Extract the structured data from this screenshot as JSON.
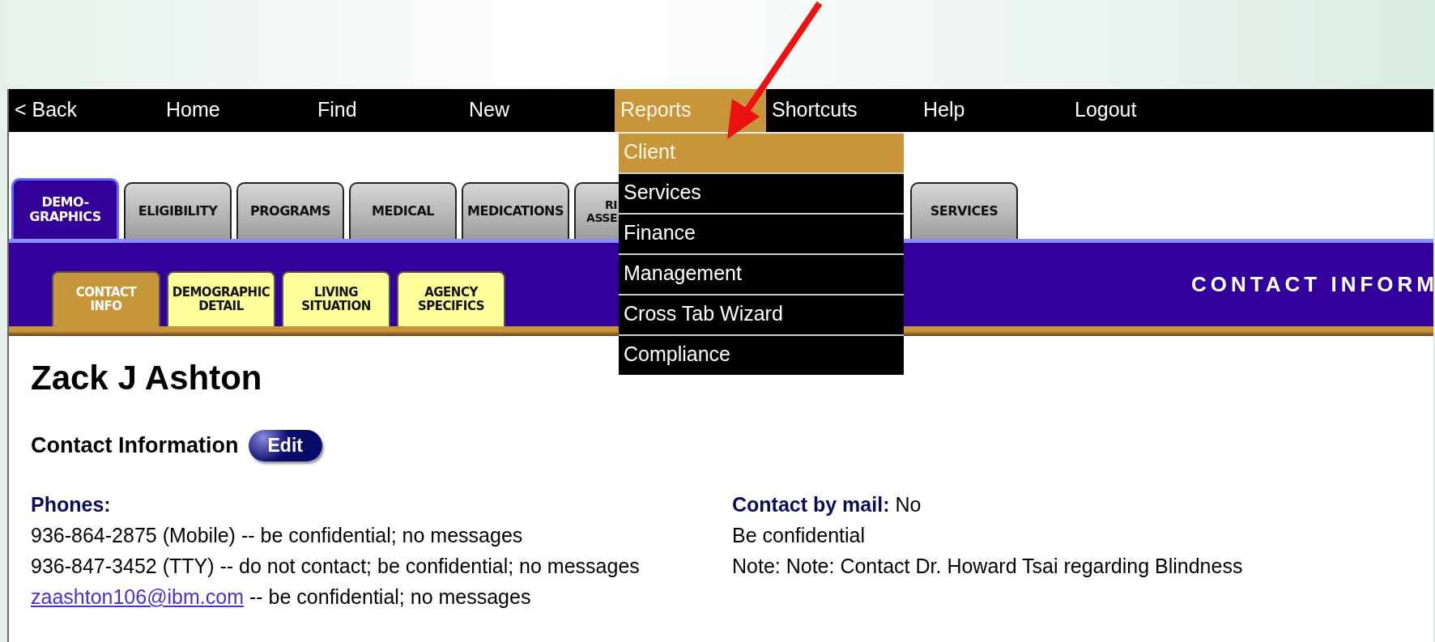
{
  "nav": [
    {
      "label": "< Back",
      "selected": false
    },
    {
      "label": "Home",
      "selected": false
    },
    {
      "label": "Find",
      "selected": false
    },
    {
      "label": "New",
      "selected": false
    },
    {
      "label": "Reports",
      "selected": true
    },
    {
      "label": "Shortcuts",
      "selected": false
    },
    {
      "label": "Help",
      "selected": false
    },
    {
      "label": "Logout",
      "selected": false
    }
  ],
  "reports_menu": [
    {
      "label": "Client",
      "selected": true
    },
    {
      "label": "Services",
      "selected": false
    },
    {
      "label": "Finance",
      "selected": false
    },
    {
      "label": "Management",
      "selected": false
    },
    {
      "label": "Cross Tab Wizard",
      "selected": false
    },
    {
      "label": "Compliance",
      "selected": false
    }
  ],
  "tabs": [
    {
      "lines": [
        "DEMO-",
        "GRAPHICS"
      ],
      "selected": true
    },
    {
      "lines": [
        "ELIGIBILITY"
      ],
      "selected": false
    },
    {
      "lines": [
        "PROGRAMS"
      ],
      "selected": false
    },
    {
      "lines": [
        "MEDICAL"
      ],
      "selected": false
    },
    {
      "lines": [
        "MEDICATIONS"
      ],
      "selected": false
    },
    {
      "lines": [
        "RI",
        "ASSE"
      ],
      "selected": false
    },
    {
      "lines": [
        "SERVICES"
      ],
      "selected": false
    }
  ],
  "subtabs": [
    {
      "lines": [
        "CONTACT",
        "INFO"
      ],
      "selected": true
    },
    {
      "lines": [
        "DEMOGRAPHIC",
        "DETAIL"
      ],
      "selected": false
    },
    {
      "lines": [
        "LIVING",
        "SITUATION"
      ],
      "selected": false
    },
    {
      "lines": [
        "AGENCY",
        "SPECIFICS"
      ],
      "selected": false
    }
  ],
  "section_title": "CONTACT INFORM",
  "client_name": "Zack J Ashton",
  "contact_heading": "Contact Information",
  "edit_button": "Edit",
  "phones": {
    "heading": "Phones:",
    "lines": [
      {
        "kind": "text",
        "text": "936-864-2875 (Mobile) -- be confidential; no messages"
      },
      {
        "kind": "text",
        "text": "936-847-3452 (TTY) -- do not contact; be confidential; no messages"
      },
      {
        "kind": "email",
        "link": "zaashton106@ibm.com",
        "text": "-- be confidential; no messages"
      }
    ]
  },
  "mail": {
    "label": "Contact by mail:",
    "value": "No",
    "lines": [
      "Be confidential",
      "Note: Note: Contact Dr. Howard Tsai regarding Blindness"
    ]
  }
}
